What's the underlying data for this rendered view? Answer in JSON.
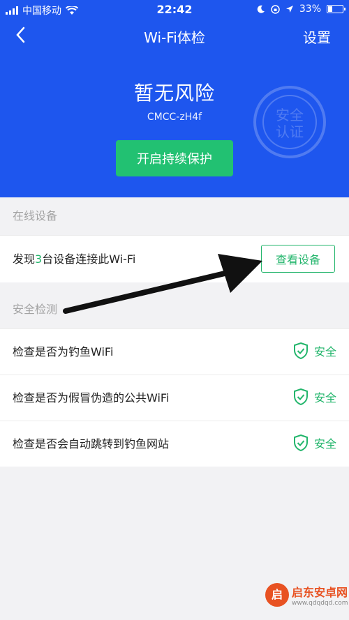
{
  "status": {
    "carrier": "中国移动",
    "time": "22:42",
    "battery": "33%"
  },
  "nav": {
    "title": "Wi-Fi体检",
    "settings": "设置"
  },
  "hero": {
    "headline": "暂无风险",
    "ssid": "CMCC-zH4f",
    "protect_button": "开启持续保护"
  },
  "online": {
    "header": "在线设备",
    "prefix": "发现",
    "count": "3",
    "suffix": "台设备连接此Wi-Fi",
    "view_button": "查看设备"
  },
  "security": {
    "header": "安全检测",
    "checks": [
      {
        "label": "检查是否为钓鱼WiFi",
        "status": "安全"
      },
      {
        "label": "检查是否为假冒伪造的公共WiFi",
        "status": "安全"
      },
      {
        "label": "检查是否会自动跳转到钓鱼网站",
        "status": "安全"
      }
    ]
  },
  "stamp": {
    "text1": "安全",
    "text2": "认证"
  },
  "watermark": {
    "logo": "启",
    "title": "启东安卓网",
    "url": "www.qdqdqd.com"
  },
  "colors": {
    "header_blue": "#1e56ee",
    "green": "#22b56b",
    "button_green": "#22c172",
    "page_bg": "#f2f2f4"
  }
}
